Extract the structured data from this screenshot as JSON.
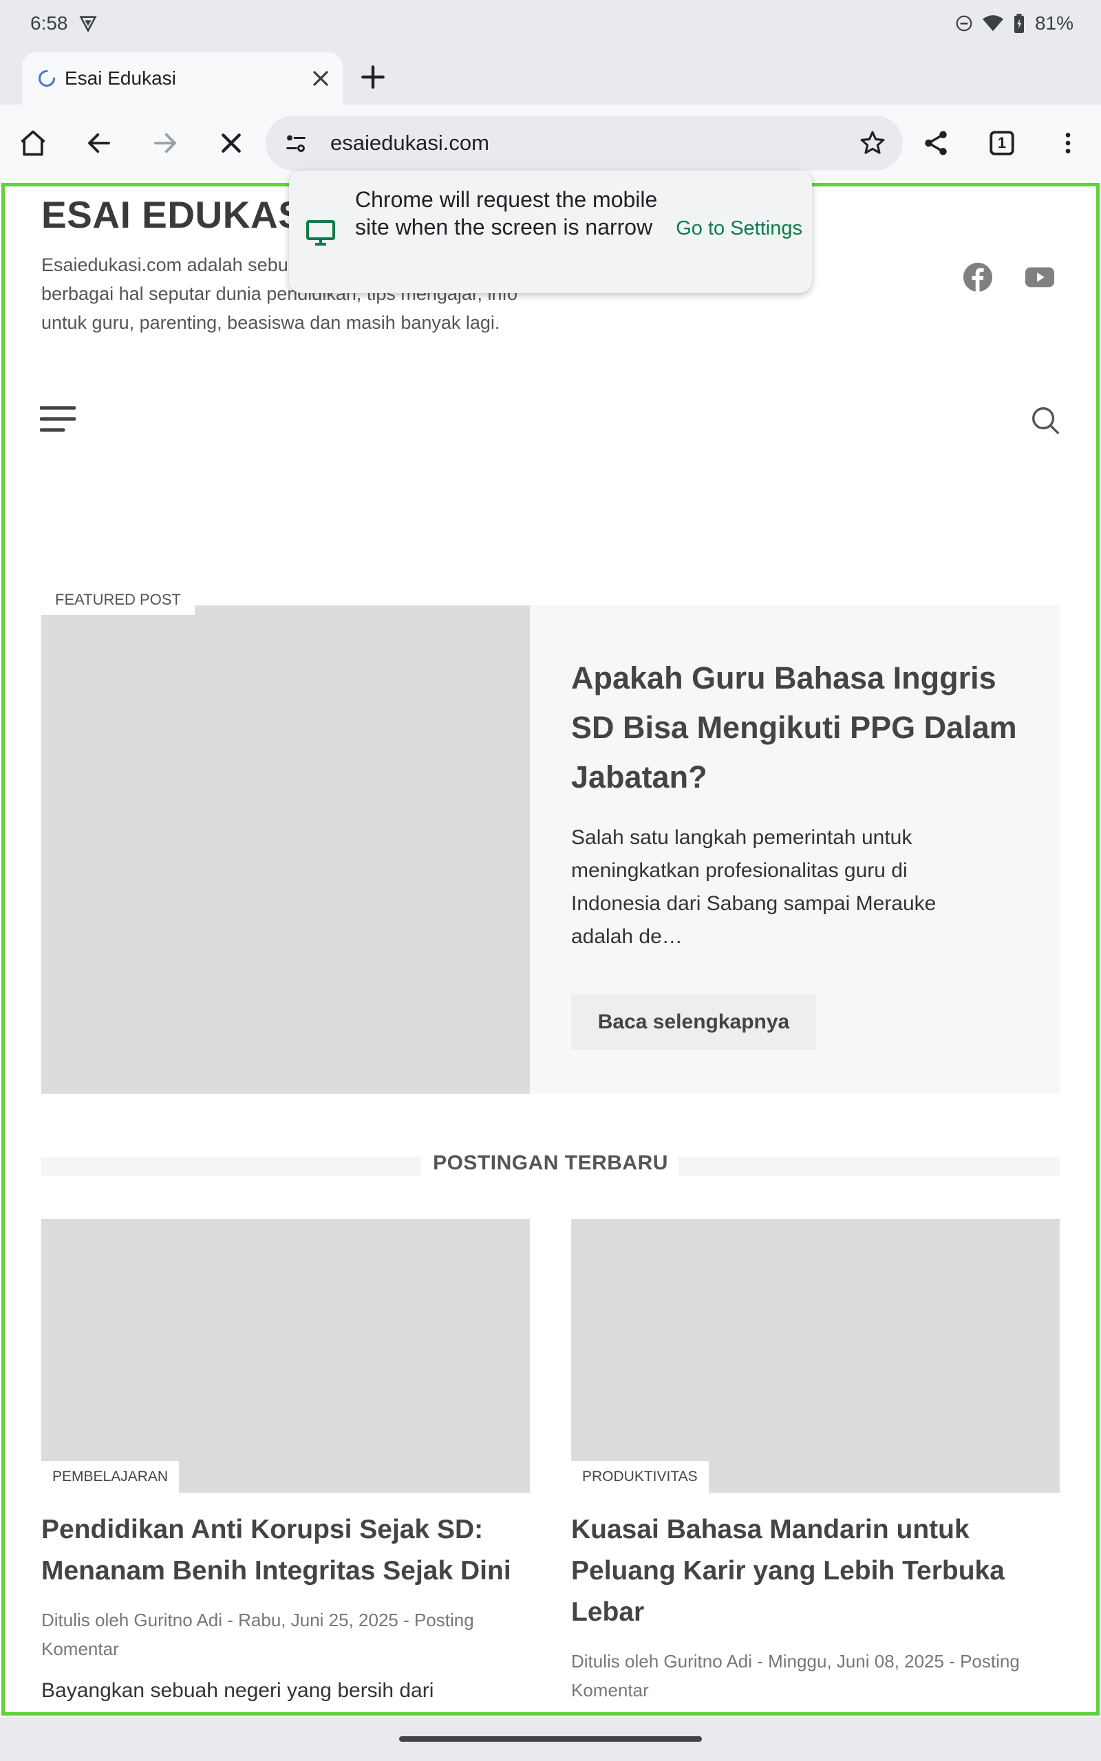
{
  "status_bar": {
    "time": "6:58",
    "battery": "81%"
  },
  "browser": {
    "tab_title": "Esai Edukasi",
    "url": "esaiedukasi.com",
    "tab_count": "1"
  },
  "popup": {
    "message": "Chrome will request the mobile site when the screen is narrow",
    "action": "Go to Settings"
  },
  "site": {
    "title": "ESAI EDUKASI",
    "description": "Esaiedukasi.com adalah sebuah blog yang membahas berbagai hal seputar dunia pendidikan, tips mengajar, info untuk guru, parenting, beasiswa dan masih banyak lagi."
  },
  "featured": {
    "label": "FEATURED POST",
    "title": "Apakah Guru Bahasa Inggris SD Bisa Mengikuti PPG Dalam Jabatan?",
    "excerpt": "Salah satu langkah pemerintah untuk meningkatkan profesionalitas guru di Indonesia dari Sabang sampai Merauke adalah de…",
    "button": "Baca selengkapnya"
  },
  "recent": {
    "heading": "POSTINGAN TERBARU",
    "posts": [
      {
        "category": "PEMBELAJARAN",
        "title": "Pendidikan Anti Korupsi Sejak SD: Menanam Benih Integritas Sejak Dini",
        "meta": "Ditulis oleh Guritno Adi  -  Rabu, Juni 25, 2025  -  Posting Komentar",
        "excerpt": "Bayangkan sebuah negeri yang bersih dari"
      },
      {
        "category": "PRODUKTIVITAS",
        "title": "Kuasai Bahasa Mandarin untuk Peluang Karir yang Lebih Terbuka Lebar",
        "meta": "Ditulis oleh Guritno Adi  -  Minggu, Juni 08, 2025  -  Posting Komentar",
        "excerpt": ""
      }
    ]
  },
  "colors": {
    "accent_green": "#61d13d",
    "link_green": "#127a4a",
    "placeholder_gray": "#dadcde"
  }
}
